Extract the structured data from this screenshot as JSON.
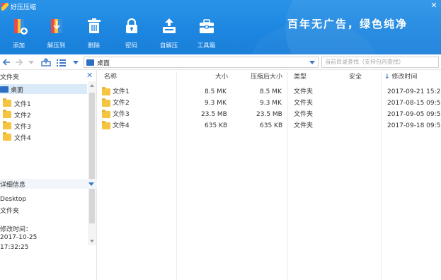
{
  "app": {
    "title": "好压压缩",
    "slogan": "百年无广告，绿色纯净"
  },
  "window_controls": {
    "close_glyph": "✕"
  },
  "toolbar": {
    "items": [
      {
        "label": "添加",
        "icon": "add-archive-icon"
      },
      {
        "label": "解压到",
        "icon": "extract-to-icon"
      },
      {
        "label": "删除",
        "icon": "delete-icon"
      },
      {
        "label": "密码",
        "icon": "password-lock-icon"
      },
      {
        "label": "自解压",
        "icon": "self-extract-icon"
      },
      {
        "label": "工具箱",
        "icon": "toolbox-icon"
      }
    ]
  },
  "nav": {
    "address": "桌面",
    "search_placeholder": "当前目录查找（支持包内查找）"
  },
  "left": {
    "tree_title": "文件夹",
    "close_glyph": "✕",
    "tree": [
      "桌面",
      "文件1",
      "文件2",
      "文件3",
      "文件4"
    ],
    "detail_title": "详细信息",
    "detail": {
      "name": "Desktop",
      "type": "文件夹",
      "modified_label": "修改时间：",
      "date": "2017-10-25",
      "time": "17:32:25"
    }
  },
  "list": {
    "columns": {
      "name": "名称",
      "size": "大小",
      "compressed": "压缩后大小",
      "type": "类型",
      "security": "安全",
      "modified": "修改时间",
      "sort_glyph": "↓"
    },
    "rows": [
      {
        "name": "文件1",
        "size": "8.5 MK",
        "compressed": "8.5 MK",
        "type": "文件夹",
        "security": "",
        "modified": "2017-09-21 15:2"
      },
      {
        "name": "文件2",
        "size": "9.3 MK",
        "compressed": "9.3 MK",
        "type": "文件夹",
        "security": "",
        "modified": "2017-08-15 09:5"
      },
      {
        "name": "文件3",
        "size": "23.5 MB",
        "compressed": "23.5 MB",
        "type": "文件夹",
        "security": "",
        "modified": "2017-09-05 09:5"
      },
      {
        "name": "文件4",
        "size": "635 KB",
        "compressed": "635 KB",
        "type": "文件夹",
        "security": "",
        "modified": "2017-09-18 09:5"
      }
    ]
  },
  "colors": {
    "header_blue": "#1d86e0",
    "accent_blue": "#3a78c7",
    "folder_yellow": "#f5c542",
    "selection": "#dbeaf9"
  }
}
